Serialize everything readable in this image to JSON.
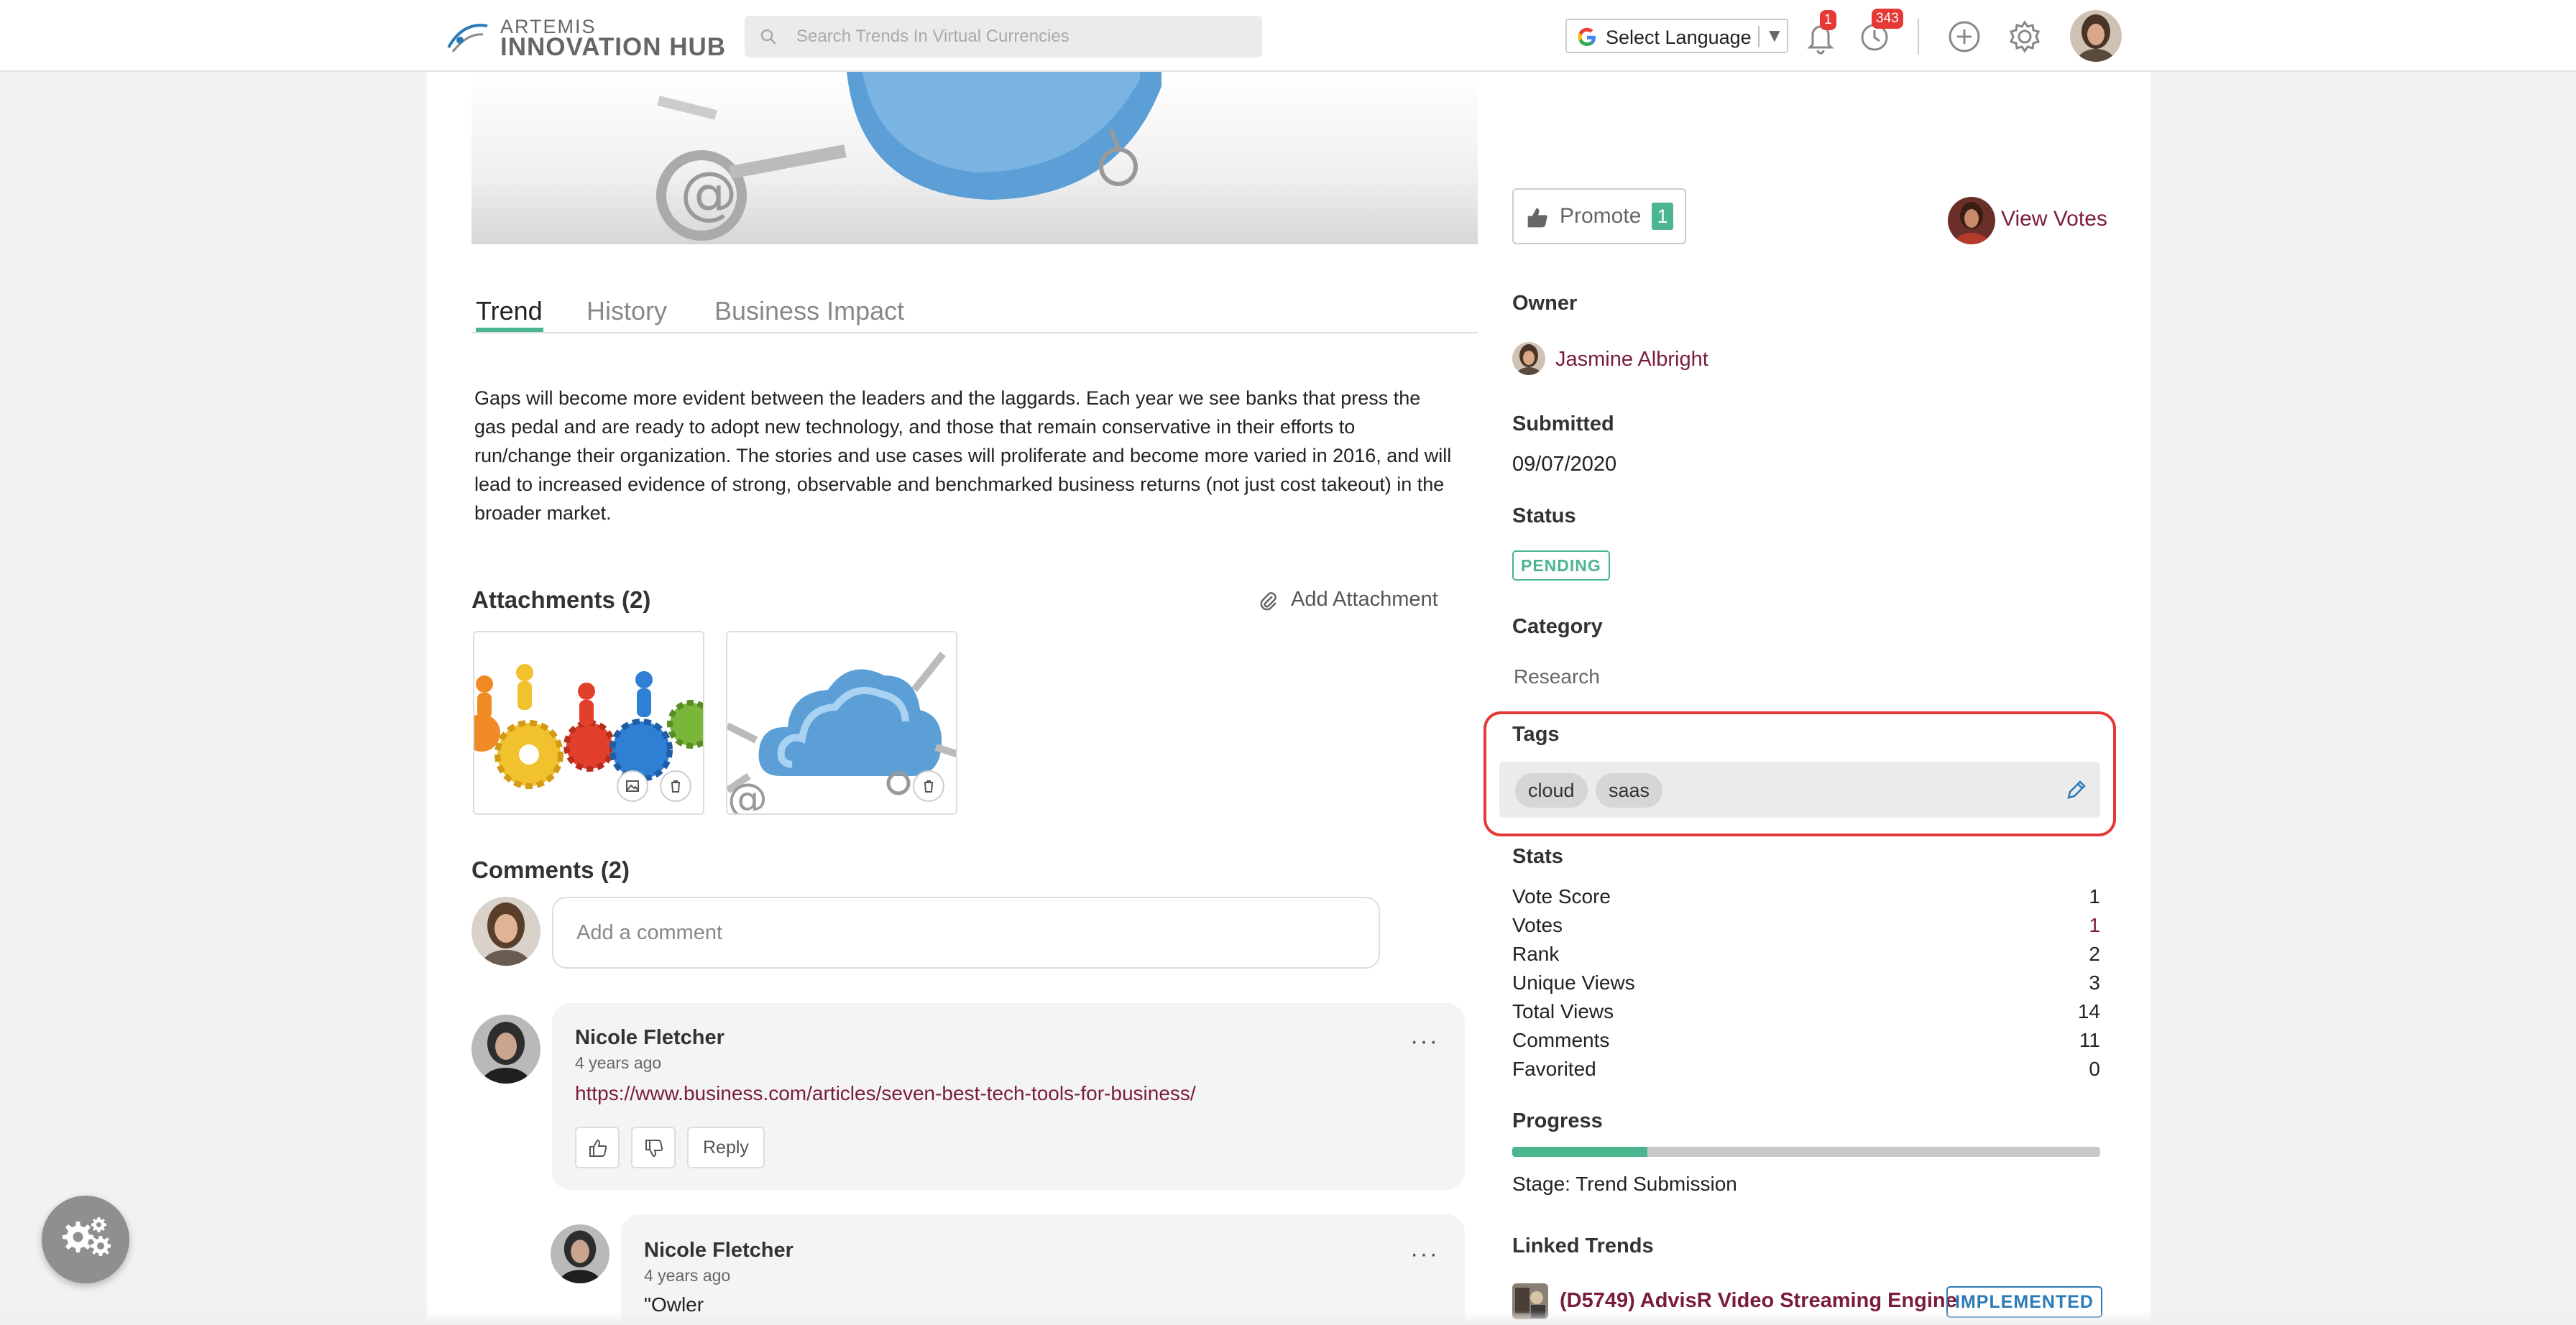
{
  "header": {
    "logo_top": "ARTEMIS",
    "logo_bottom": "INNOVATION HUB",
    "search_placeholder": "Search Trends In Virtual Currencies",
    "language_label": "Select Language",
    "notifications_count": "1",
    "activity_count": "343"
  },
  "trend": {
    "tabs": [
      "Trend",
      "History",
      "Business Impact"
    ],
    "active_tab": "Trend",
    "description": "Gaps will become more evident between the leaders and the laggards. Each year we see banks that press the gas pedal and are ready to adopt new technology, and those that remain conservative in their efforts to run/change their organization. The stories and use cases will proliferate and become more varied in 2016, and will lead to increased evidence of strong, observable and benchmarked business returns (not just cost takeout) in the broader market."
  },
  "attachments": {
    "title": "Attachments (2)",
    "add_label": "Add Attachment"
  },
  "comments": {
    "title": "Comments (2)",
    "placeholder": "Add a comment",
    "items": [
      {
        "author": "Nicole Fletcher",
        "time": "4 years ago",
        "link": "https://www.business.com/articles/seven-best-tech-tools-for-business/",
        "reply_label": "Reply"
      },
      {
        "author": "Nicole Fletcher",
        "time": "4 years ago",
        "text": "\"Owler"
      }
    ]
  },
  "sidebar": {
    "promote_label": "Promote",
    "promote_count": "1",
    "view_votes_label": "View Votes",
    "owner_label": "Owner",
    "owner_name": "Jasmine Albright",
    "submitted_label": "Submitted",
    "submitted_date": "09/07/2020",
    "status_label": "Status",
    "status_value": "PENDING",
    "category_label": "Category",
    "category_value": "Research",
    "tags_label": "Tags",
    "tags": [
      "cloud",
      "saas"
    ],
    "stats_label": "Stats",
    "stats": [
      {
        "label": "Vote Score",
        "value": "1"
      },
      {
        "label": "Votes",
        "value": "1"
      },
      {
        "label": "Rank",
        "value": "2"
      },
      {
        "label": "Unique Views",
        "value": "3"
      },
      {
        "label": "Total Views",
        "value": "14"
      },
      {
        "label": "Comments",
        "value": "11"
      },
      {
        "label": "Favorited",
        "value": "0"
      }
    ],
    "progress_label": "Progress",
    "progress_fraction": 0.23,
    "stage_text": "Stage: Trend Submission",
    "linked_label": "Linked Trends",
    "linked_trend_name": "(D5749) AdvisR Video Streaming Engine",
    "linked_trend_status": "IMPLEMENTED"
  },
  "colors": {
    "accent_green": "#4bb68e",
    "link_maroon": "#7a1c3c",
    "highlight_red": "#e53935",
    "implemented_blue": "#2a7ab8"
  },
  "icons": {
    "logo": "artemis-swoosh-icon",
    "search": "search-icon",
    "language": "google-g-icon",
    "notifications": "bell-icon",
    "activity": "history-clock-icon",
    "add": "plus-circle-icon",
    "settings": "gear-icon",
    "attachment": "paperclip-icon",
    "edit": "pencil-icon",
    "floating": "gears-icon"
  }
}
